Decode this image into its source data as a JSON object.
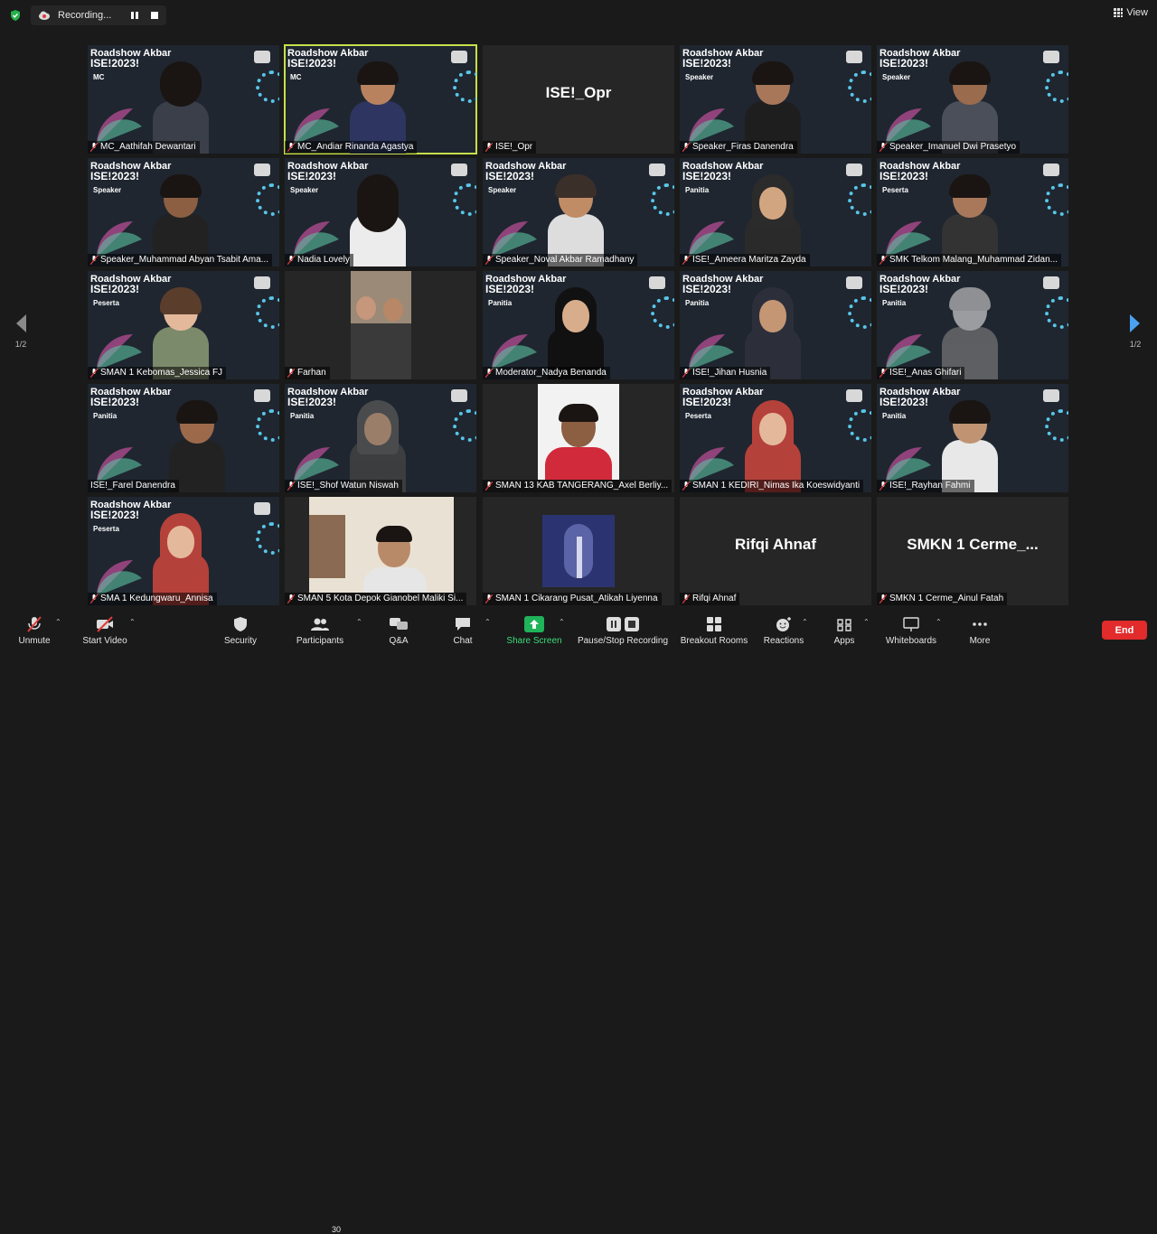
{
  "recording": {
    "label": "Recording..."
  },
  "view": {
    "label": "View"
  },
  "event_banner": {
    "line1": "Roadshow Akbar",
    "line2": "ISE!2023!"
  },
  "pagination": {
    "left": "1/2",
    "right": "1/2"
  },
  "tiles": [
    {
      "name": "MC_Aathifah Dewantari",
      "role": "MC",
      "active": false
    },
    {
      "name": "MC_Andiar Rinanda Agastya",
      "role": "MC",
      "active": true
    },
    {
      "name": "ISE!_Opr",
      "display_name": "ISE!_Opr"
    },
    {
      "name": "Speaker_Firas Danendra",
      "role": "Speaker"
    },
    {
      "name": "Speaker_Imanuel Dwi Prasetyo",
      "role": "Speaker"
    },
    {
      "name": "Speaker_Muhammad Abyan Tsabit Ama...",
      "role": "Speaker"
    },
    {
      "name": "Nadia Lovely",
      "role": "Speaker"
    },
    {
      "name": "Speaker_Noval Akbar Ramadhany",
      "role": "Speaker"
    },
    {
      "name": "ISE!_Ameera Maritza Zayda",
      "role": "Panitia"
    },
    {
      "name": "SMK Telkom Malang_Muhammad Zidan...",
      "role": "Peserta"
    },
    {
      "name": "SMAN 1 Kebomas_Jessica FJ",
      "role": "Peserta"
    },
    {
      "name": "Farhan"
    },
    {
      "name": "Moderator_Nadya Benanda",
      "role": "Panitia"
    },
    {
      "name": "ISE!_Jihan Husnia",
      "role": "Panitia"
    },
    {
      "name": "ISE!_Anas Ghifari",
      "role": "Panitia"
    },
    {
      "name": "ISE!_Farel Danendra",
      "role": "Panitia"
    },
    {
      "name": "ISE!_Shof Watun Niswah",
      "role": "Panitia"
    },
    {
      "name": "SMAN 13 KAB TANGERANG_Axel Berliy..."
    },
    {
      "name": "SMAN 1 KEDIRI_Nimas Ika Koeswidyanti",
      "role": "Peserta"
    },
    {
      "name": "ISE!_Rayhan Fahmi",
      "role": "Panitia"
    },
    {
      "name": "SMA 1 Kedungwaru_Annisa",
      "role": "Peserta"
    },
    {
      "name": "SMAN 5 Kota Depok Gianobel Maliki Si..."
    },
    {
      "name": "SMAN 1 Cikarang Pusat_Atikah Liyenna"
    },
    {
      "name": "Rifqi Ahnaf",
      "display_name": "Rifqi Ahnaf"
    },
    {
      "name": "SMKN 1 Cerme_Ainul Fatah",
      "display_name": "SMKN 1 Cerme_..."
    }
  ],
  "toolbar": {
    "unmute": "Unmute",
    "start_video": "Start Video",
    "security": "Security",
    "participants": "Participants",
    "participants_count": "30",
    "qa": "Q&A",
    "chat": "Chat",
    "share_screen": "Share Screen",
    "pause_recording": "Pause/Stop Recording",
    "breakout_rooms": "Breakout Rooms",
    "reactions": "Reactions",
    "apps": "Apps",
    "whiteboards": "Whiteboards",
    "more": "More",
    "end": "End"
  },
  "colors": {
    "active_border": "#c6e04a",
    "share_green": "#1fb35a",
    "end_red": "#e22b2b",
    "nav_arrow_right": "#4aa3f0"
  }
}
